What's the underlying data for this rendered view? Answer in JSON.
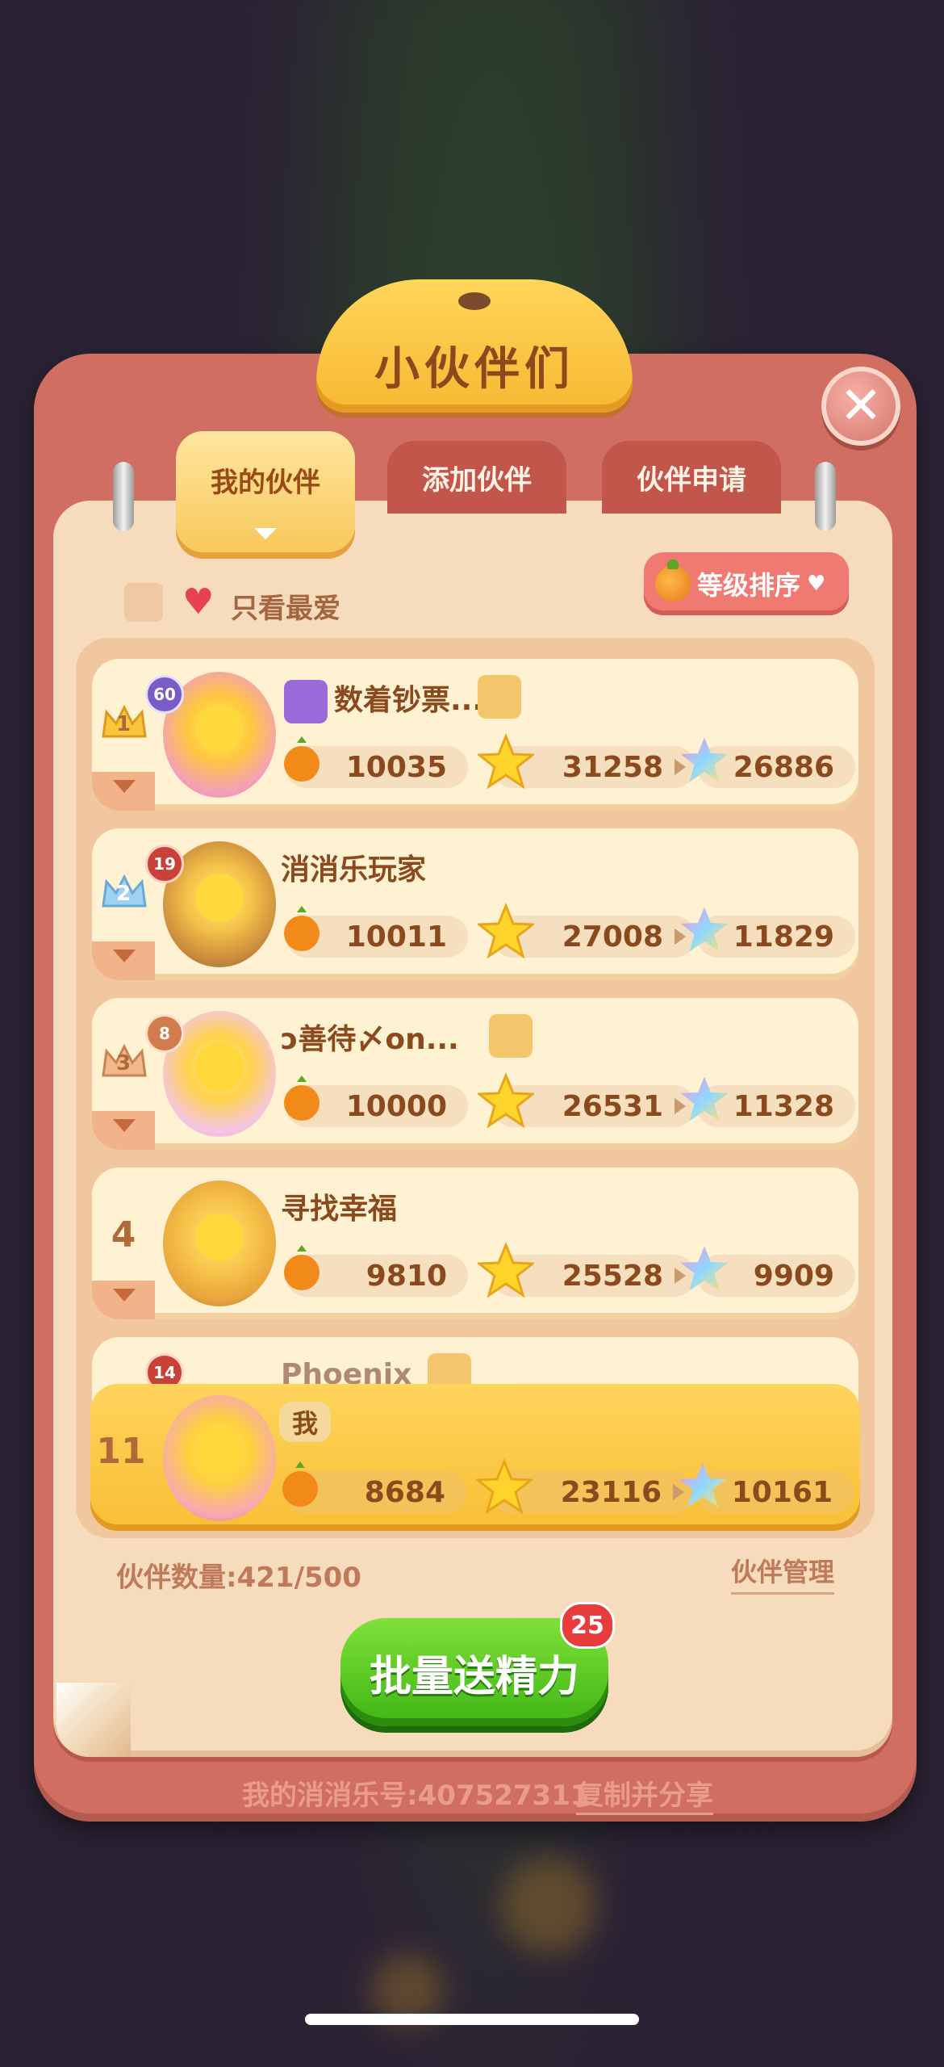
{
  "title": "小伙伴们",
  "tabs": [
    {
      "label": "我的伙伴",
      "active": true
    },
    {
      "label": "添加伙伴",
      "active": false
    },
    {
      "label": "伙伴申请",
      "active": false
    }
  ],
  "filter": {
    "fav_label": "只看最爱"
  },
  "sort": {
    "label": "等级排序"
  },
  "friends": [
    {
      "rank": "1",
      "level": "60",
      "name": "数着钞票...",
      "stat1": "10035",
      "stat2": "31258",
      "stat3": "26886"
    },
    {
      "rank": "2",
      "level": "19",
      "name": "消消乐玩家",
      "stat1": "10011",
      "stat2": "27008",
      "stat3": "11829"
    },
    {
      "rank": "3",
      "level": "8",
      "name": "ↄ善待〆on...",
      "stat1": "10000",
      "stat2": "26531",
      "stat3": "11328"
    },
    {
      "rank": "4",
      "level": "",
      "name": "寻找幸福",
      "stat1": "9810",
      "stat2": "25528",
      "stat3": "9909"
    },
    {
      "rank": "",
      "level": "14",
      "name": "Phoenix",
      "stat1": "",
      "stat2": "",
      "stat3": ""
    }
  ],
  "me": {
    "rank": "11",
    "name": "我",
    "stat1": "8684",
    "stat2": "23116",
    "stat3": "10161"
  },
  "footer": {
    "count_label": "伙伴数量:421/500",
    "manage_label": "伙伴管理",
    "send_button": "批量送精力",
    "send_badge": "25",
    "id_label": "我的消消乐号:407527311",
    "copy_label": "复制并分享"
  },
  "colors": {
    "panel": "#cf6e61",
    "accent_yellow": "#f8bf36",
    "green_button": "#3fb514"
  }
}
